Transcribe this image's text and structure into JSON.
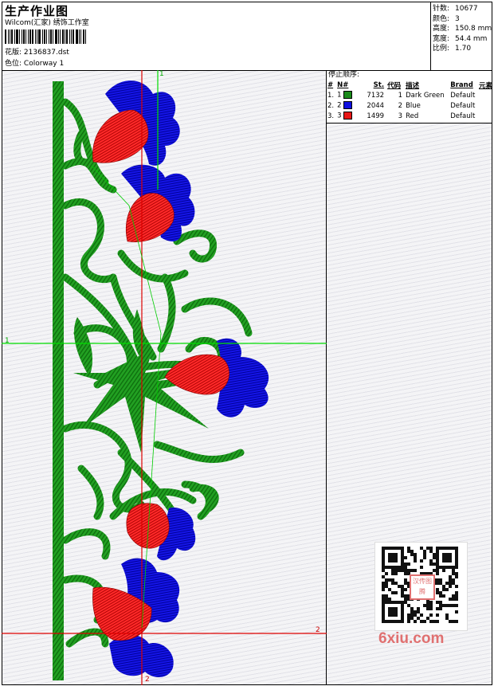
{
  "header": {
    "title": "生产作业图",
    "studio": "Wilcom(汇家) 绣饰工作室",
    "design_label": "花版:",
    "design_file": "2136837.dst",
    "colorway_label": "色位:",
    "colorway": "Colorway 1"
  },
  "stats": [
    {
      "label": "针数:",
      "value": "10677"
    },
    {
      "label": "颜色:",
      "value": "3"
    },
    {
      "label": "高度:",
      "value": "150.8 mm"
    },
    {
      "label": "宽度:",
      "value": "54.4 mm"
    },
    {
      "label": "比例:",
      "value": "1.70"
    }
  ],
  "stop_sequence": {
    "title": "停止顺序:",
    "headers": [
      "#",
      "N#",
      "St.",
      "代码",
      "描述",
      "Brand",
      "元素"
    ],
    "rows": [
      {
        "idx": "1.",
        "n": "1",
        "stitches": "7132",
        "code": "1",
        "description": "Dark Green",
        "brand": "Default",
        "color": "#1a8a1a"
      },
      {
        "idx": "2.",
        "n": "2",
        "stitches": "2044",
        "code": "2",
        "description": "Blue",
        "brand": "Default",
        "color": "#1010e0"
      },
      {
        "idx": "3.",
        "n": "3",
        "stitches": "1499",
        "code": "3",
        "description": "Red",
        "brand": "Default",
        "color": "#e81818"
      }
    ]
  },
  "axis_markers": {
    "top": "1",
    "left": "1",
    "right": "2",
    "bottom": "2"
  },
  "watermark": {
    "text": "6xiu.com",
    "seal": "汉传图腾"
  },
  "colors": {
    "green": "#22a022",
    "blue": "#1515e6",
    "red": "#ee2020",
    "guide_green": "#00dd00",
    "guide_red": "#dd0000"
  }
}
